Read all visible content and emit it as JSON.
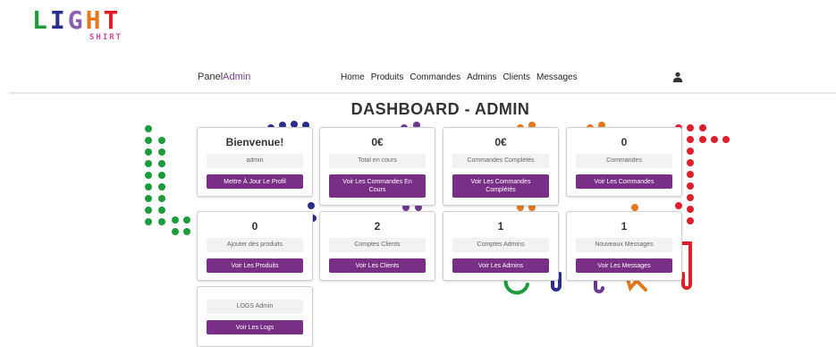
{
  "logo": {
    "big": "LIGHT",
    "small": "SHIRT"
  },
  "nav": {
    "brand_prefix": "Panel",
    "brand_accent": "Admin",
    "links": [
      "Home",
      "Produits",
      "Commandes",
      "Admins",
      "Clients",
      "Messages"
    ],
    "user_icon": "user-icon"
  },
  "page": {
    "title": "DASHBOARD - ADMIN"
  },
  "cards": [
    {
      "value": "Bienvenue!",
      "label": "admin",
      "button": "Mettre À Jour Le Profil"
    },
    {
      "value": "0€",
      "label": "Total en cours",
      "button": "Voir Les Commandes En Cours"
    },
    {
      "value": "0€",
      "label": "Commandes Complétés",
      "button": "Voir Les Commandes Complétés"
    },
    {
      "value": "0",
      "label": "Commandes",
      "button": "Voir Les Commandes"
    },
    {
      "value": "0",
      "label": "Ajouter des produits",
      "button": "Voir Les Produits"
    },
    {
      "value": "2",
      "label": "Comptes Clients",
      "button": "Voir Les Clients"
    },
    {
      "value": "1",
      "label": "Comptes Admins",
      "button": "Voir Les Admins"
    },
    {
      "value": "1",
      "label": "Nouveaux Messages",
      "button": "Voir Les Messages"
    },
    {
      "value": "",
      "label": "LOGS Admin",
      "button": "Voir Les Logs"
    }
  ],
  "colors": {
    "accent": "#7a2f86",
    "dot_green": "#1e9b3b",
    "dot_navy": "#2b2d8c",
    "dot_purple": "#6b3a8f",
    "dot_orange": "#e3781e",
    "dot_red": "#e01e2b"
  }
}
